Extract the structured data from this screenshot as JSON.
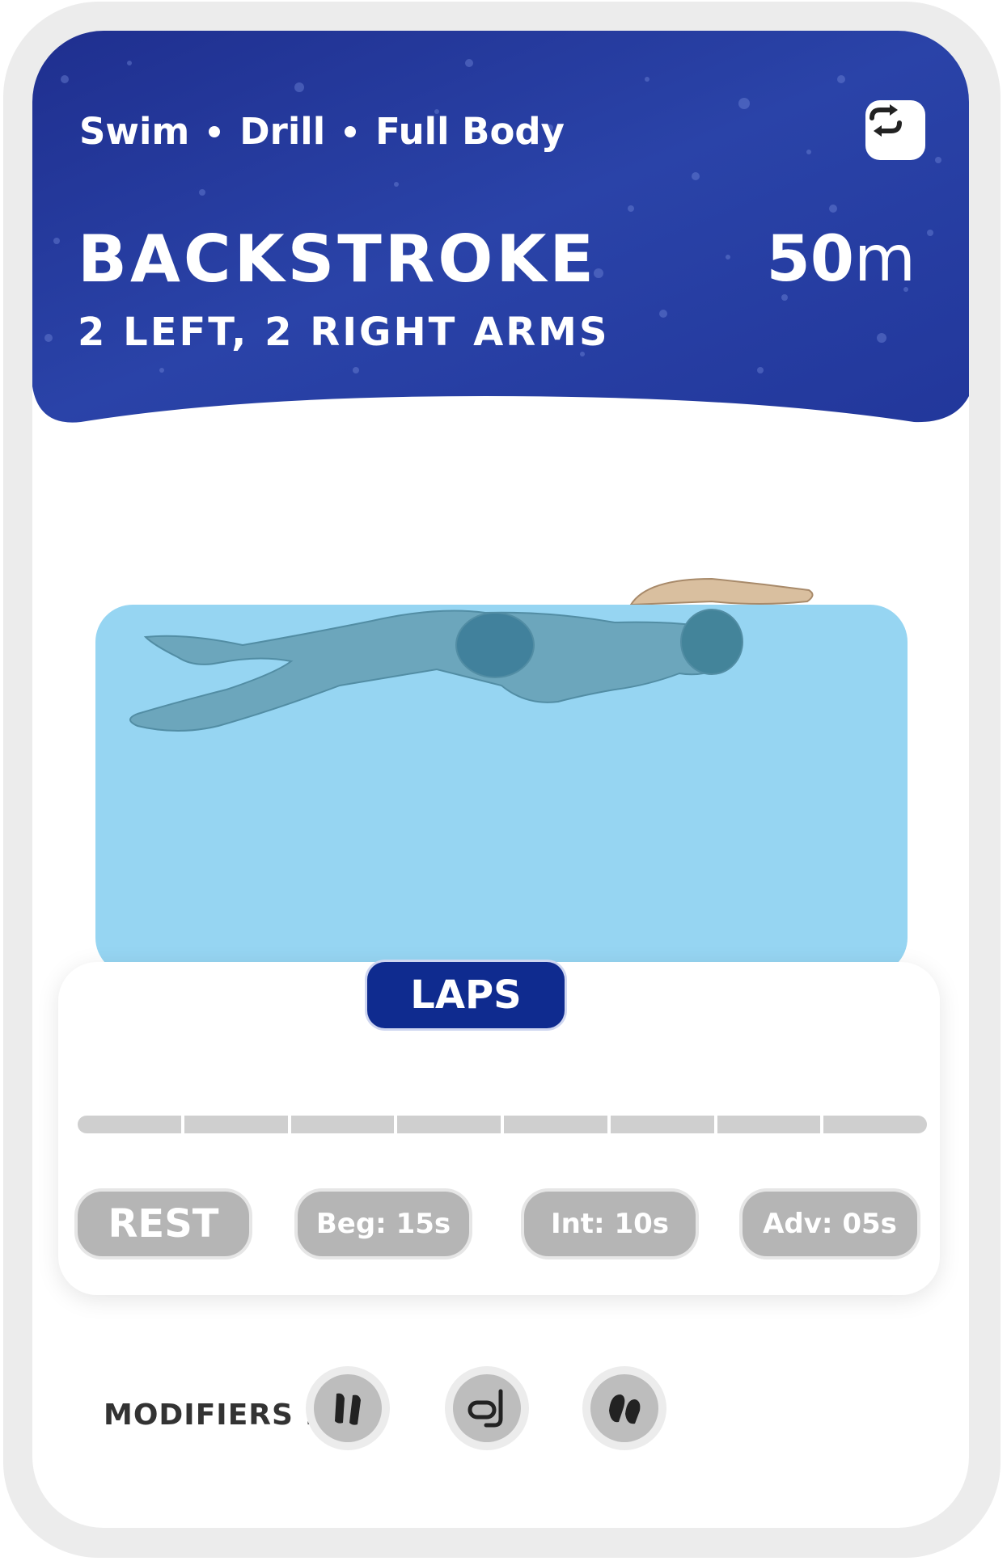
{
  "header": {
    "tags": [
      "Swim",
      "Drill",
      "Full Body"
    ],
    "title": "BACKSTROKE",
    "subtitle": "2 LEFT, 2 RIGHT ARMS",
    "distance_value": "50",
    "distance_unit": "m",
    "swap_icon": "repeat-swap-icon"
  },
  "laps": {
    "label": "LAPS",
    "segments": 8,
    "completed": 0
  },
  "rest": {
    "label": "REST",
    "levels": [
      {
        "label": "Beg: 15s"
      },
      {
        "label": "Int: 10s"
      },
      {
        "label": "Adv: 05s"
      }
    ]
  },
  "modifiers": {
    "label": "MODIFIERS :",
    "icons": [
      "fins-icon",
      "snorkel-icon",
      "paddles-icon"
    ]
  },
  "colors": {
    "header_blue": "#233a9e",
    "water": "#96d5f2",
    "laps_pill": "#0f2b8f",
    "pill_grey": "#b5b5b5"
  }
}
